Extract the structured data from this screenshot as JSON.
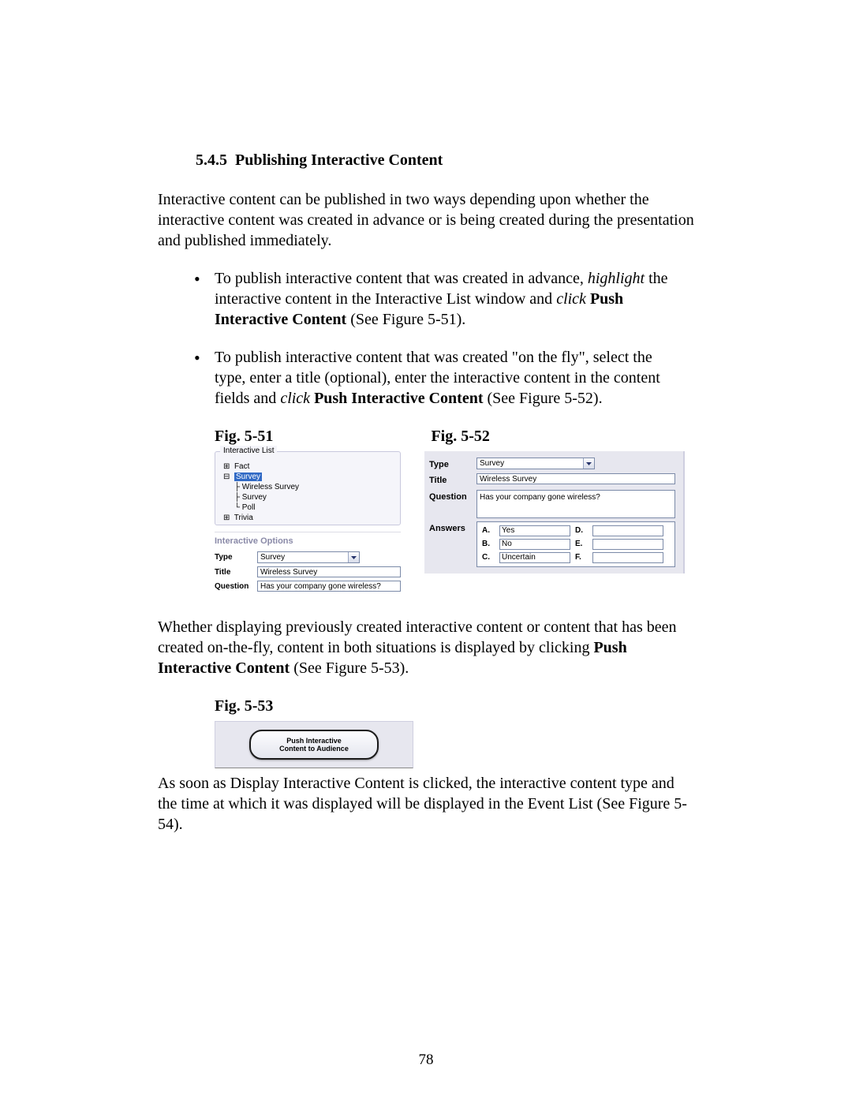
{
  "section": {
    "number": "5.4.5",
    "title": "Publishing Interactive Content"
  },
  "para1": "Interactive content can be published in two ways depending upon whether the interactive content was created in advance or is being created during the presentation and published immediately.",
  "bullet1": {
    "pre": "To publish interactive content that was created in advance, ",
    "highlight_word": "highlight",
    "mid": " the interactive content in the Interactive List window and ",
    "click_word": "click",
    "bold_cmd": " Push Interactive Content",
    "post": " (See Figure 5-51)."
  },
  "bullet2": {
    "pre": "To publish interactive content that was created \"on the fly\", select the type, enter a title (optional), enter the interactive content in the content fields and ",
    "click_word": "click",
    "bold_cmd": " Push Interactive Content",
    "post": " (See Figure 5-52)."
  },
  "fig51_label": "Fig.  5-51",
  "fig52_label": "Fig. 5-52",
  "fig53_label": "Fig. 5-53",
  "tree": {
    "legend": "Interactive List",
    "fact": "Fact",
    "survey": "Survey",
    "wireless": "Wireless Survey",
    "survey2": "Survey",
    "poll": "Poll",
    "trivia": "Trivia"
  },
  "options": {
    "header": "Interactive Options",
    "type_label": "Type",
    "type_value": "Survey",
    "title_label": "Title",
    "title_value": "Wireless Survey",
    "question_label": "Question",
    "question_value": "Has your company gone wireless?"
  },
  "fig52": {
    "type_label": "Type",
    "type_value": "Survey",
    "title_label": "Title",
    "title_value": "Wireless Survey",
    "question_label": "Question",
    "question_value": "Has your company gone wireless?",
    "answers_label": "Answers",
    "a": "A.",
    "a_val": "Yes",
    "b": "B.",
    "b_val": "No",
    "c": "C.",
    "c_val": "Uncertain",
    "d": "D.",
    "d_val": "",
    "e": "E.",
    "e_val": "",
    "f": "F.",
    "f_val": ""
  },
  "para2": {
    "pre": "Whether displaying previously created interactive content or content that has been created on-the-fly, content in both situations is displayed by clicking ",
    "bold_cmd": "Push Interactive Content",
    "post": " (See Figure 5-53)."
  },
  "fig53_button_line1": "Push Interactive",
  "fig53_button_line2": "Content to Audience",
  "para3": "As soon as Display Interactive Content is clicked, the interactive content type and the time at which it was displayed will be displayed in the Event List (See Figure 5-54).",
  "page_number": "78"
}
